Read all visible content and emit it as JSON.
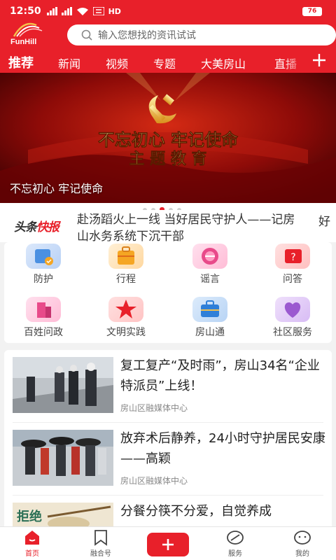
{
  "status_bar": {
    "time": "12:50",
    "network_label": "HD",
    "battery": "76"
  },
  "header": {
    "logo_text": "FunHill",
    "search_placeholder": "输入您想找的资讯试试"
  },
  "tabs": [
    {
      "label": "推荐",
      "active": true
    },
    {
      "label": "新闻"
    },
    {
      "label": "视频"
    },
    {
      "label": "专题"
    },
    {
      "label": "大美房山"
    },
    {
      "label": "直播"
    }
  ],
  "banner": {
    "headline_line1": "不忘初心 牢记使命",
    "headline_line2": "主 题 教 育",
    "caption": "不忘初心 牢记使命",
    "slide_count": 5,
    "active_slide": 2
  },
  "ticker": {
    "logo_part1": "头条",
    "logo_part2": "快报",
    "text": "赴汤蹈火上一线 当好居民守护人——记房山水务系统下沉干部",
    "peek": "好"
  },
  "quick_grid": [
    {
      "label": "防护",
      "icon": "shield-icon",
      "color": "#4a90e2"
    },
    {
      "label": "行程",
      "icon": "suitcase-icon",
      "color": "#f5a623"
    },
    {
      "label": "谣言",
      "icon": "rumor-icon",
      "color": "#e84a8a"
    },
    {
      "label": "问答",
      "icon": "question-icon",
      "color": "#e8202a"
    },
    {
      "label": "百姓问政",
      "icon": "building-icon",
      "color": "#e84a8a"
    },
    {
      "label": "文明实践",
      "icon": "star-icon",
      "color": "#e8202a"
    },
    {
      "label": "房山通",
      "icon": "briefcase-icon",
      "color": "#2f7fd8"
    },
    {
      "label": "社区服务",
      "icon": "heart-icon",
      "color": "#9b59d0"
    }
  ],
  "news": [
    {
      "title": "复工复产“及时雨”，房山34名“企业特派员”上线！",
      "source": "房山区融媒体中心"
    },
    {
      "title": "放弃术后静养，24小时守护居民安康——高颖",
      "source": "房山区融媒体中心"
    },
    {
      "title": "分餐分筷不分爱，自觉养成",
      "source": "",
      "thumb_text": "拒绝"
    }
  ],
  "bottom_nav": [
    {
      "label": "首页",
      "icon": "home-icon",
      "active": true
    },
    {
      "label": "融合号",
      "icon": "bookmark-icon"
    },
    {
      "label": "",
      "icon": "plus-icon"
    },
    {
      "label": "服务",
      "icon": "service-icon"
    },
    {
      "label": "我的",
      "icon": "profile-icon"
    }
  ],
  "colors": {
    "brand_red": "#e8202a",
    "banner_gold": "#f5c04a"
  }
}
